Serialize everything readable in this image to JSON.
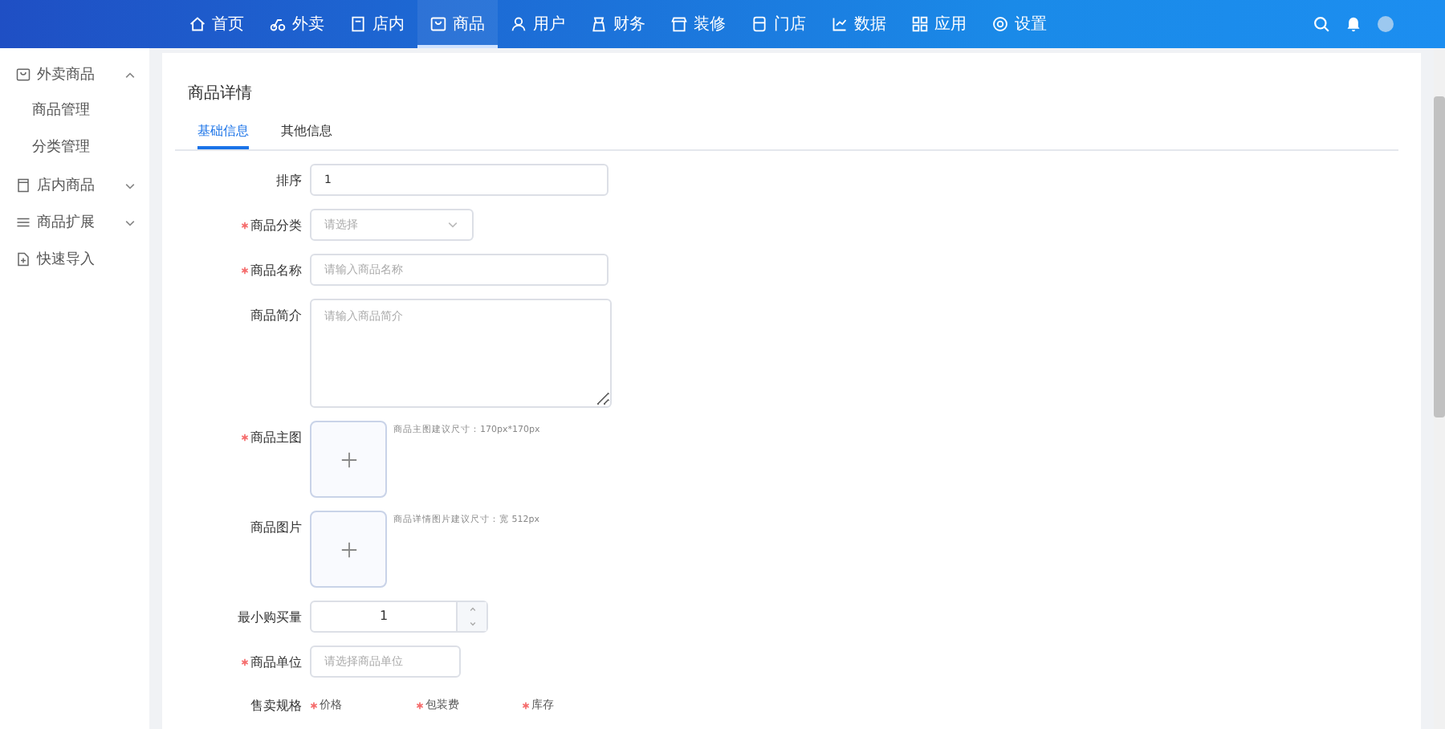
{
  "nav": {
    "items": [
      {
        "label": "首页",
        "selected": false
      },
      {
        "label": "外卖",
        "selected": false
      },
      {
        "label": "店内",
        "selected": false
      },
      {
        "label": "商品",
        "selected": true
      },
      {
        "label": "用户",
        "selected": false
      },
      {
        "label": "财务",
        "selected": false
      },
      {
        "label": "装修",
        "selected": false
      },
      {
        "label": "门店",
        "selected": false
      },
      {
        "label": "数据",
        "selected": false
      },
      {
        "label": "应用",
        "selected": false
      },
      {
        "label": "设置",
        "selected": false
      }
    ]
  },
  "sidebar": {
    "items": [
      {
        "label": "外卖商品",
        "expanded": true,
        "children": [
          {
            "label": "商品管理"
          },
          {
            "label": "分类管理"
          }
        ]
      },
      {
        "label": "店内商品",
        "expanded": false
      },
      {
        "label": "商品扩展",
        "expanded": false
      },
      {
        "label": "快速导入"
      }
    ]
  },
  "page": {
    "title": "商品详情",
    "tabs": [
      {
        "label": "基础信息",
        "selected": true
      },
      {
        "label": "其他信息",
        "selected": false
      }
    ],
    "fields": [
      {
        "kind": "input",
        "label": "排序",
        "required": false,
        "value": "1"
      },
      {
        "kind": "select",
        "label": "商品分类",
        "required": true,
        "placeholder": "请选择"
      },
      {
        "kind": "input",
        "label": "商品名称",
        "required": true,
        "placeholder": "请输入商品名称"
      },
      {
        "kind": "textarea",
        "label": "商品简介",
        "required": false,
        "placeholder": "请输入商品简介"
      },
      {
        "kind": "upload",
        "label": "商品主图",
        "required": true,
        "hint": "商品主图建议尺寸：170px*170px"
      },
      {
        "kind": "upload",
        "label": "商品图片",
        "required": false,
        "hint": "商品详情图片建议尺寸：宽 512px"
      },
      {
        "kind": "number",
        "label": "最小购买量",
        "required": false,
        "value": "1"
      },
      {
        "kind": "picker",
        "label": "商品单位",
        "required": true,
        "placeholder": "请选择商品单位"
      },
      {
        "kind": "spec",
        "label": "售卖规格",
        "required": false,
        "columns": [
          {
            "label": "价格",
            "required": true
          },
          {
            "label": "包装费",
            "required": true
          },
          {
            "label": "库存",
            "required": true
          }
        ]
      }
    ]
  }
}
